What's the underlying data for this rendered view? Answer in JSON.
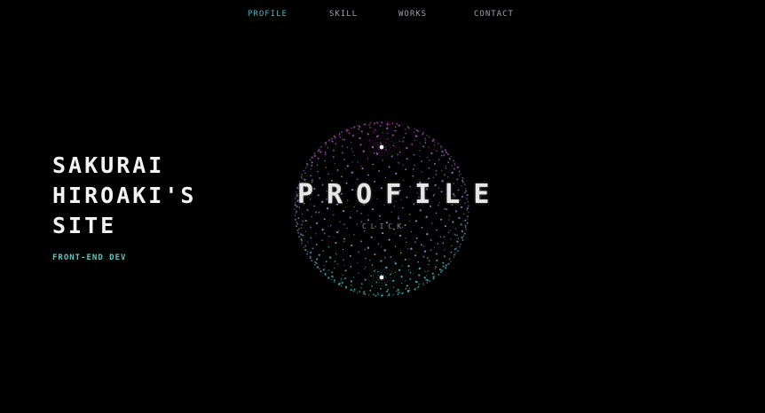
{
  "nav": {
    "items": [
      {
        "label": "PROFILE"
      },
      {
        "label": "SKILL"
      },
      {
        "label": "WORKS"
      },
      {
        "label": "CONTACT"
      }
    ]
  },
  "hero": {
    "title_lines": [
      "SAKURAI",
      "HIROAKI'S",
      "SITE"
    ],
    "subtitle": "FRONT-END DEV"
  },
  "orb": {
    "title": "PROFILE",
    "hint": "CLICK"
  },
  "colors": {
    "background": "#000000",
    "nav_active": "#4fb0c4",
    "nav_idle": "#9aa3aa",
    "subtitle": "#5cc8bf",
    "orb_top": "#c040c8",
    "orb_bottom": "#30c8c0"
  }
}
